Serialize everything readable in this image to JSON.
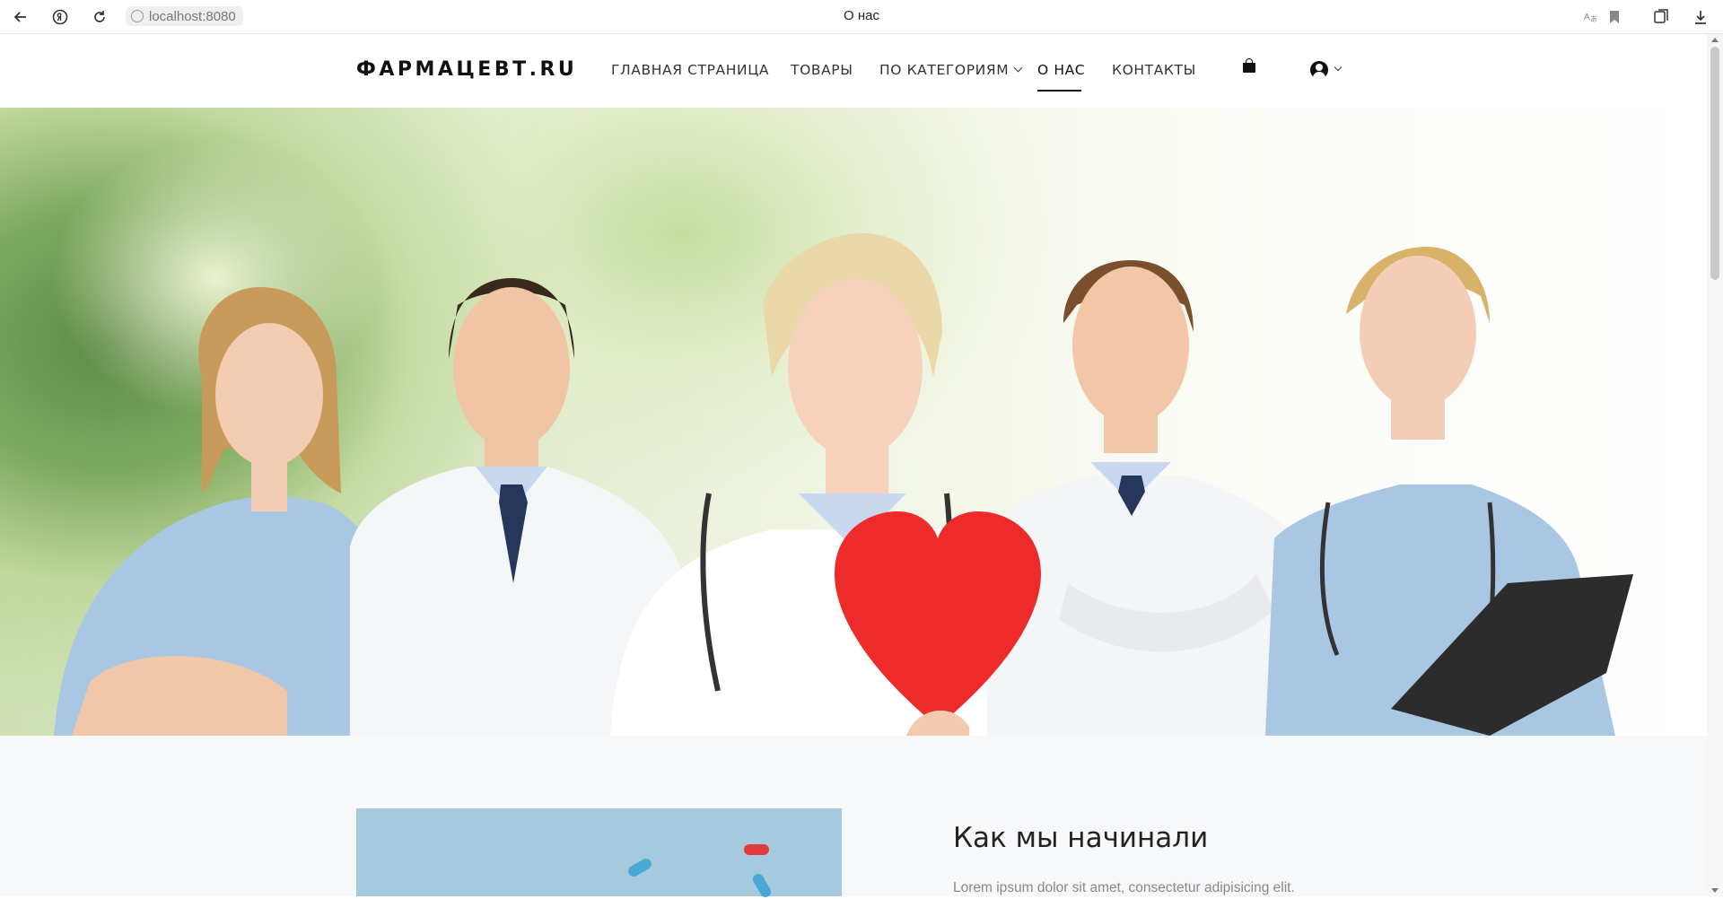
{
  "browser": {
    "url": "localhost:8080",
    "tab_title": "О нас",
    "back_icon": "back-arrow-icon",
    "reload_icon": "reload-icon"
  },
  "site": {
    "logo": "ФАРМАЦЕВТ.RU",
    "nav": [
      {
        "label": "ГЛАВНАЯ СТРАНИЦА"
      },
      {
        "label": "ТОВАРЫ"
      },
      {
        "label": "ПО КАТЕГОРИЯМ"
      },
      {
        "label": "О НАС",
        "active": true
      },
      {
        "label": "КОНТАКТЫ"
      }
    ],
    "cart_icon": "shopping-bag-icon",
    "account_icon": "user-circle-icon"
  },
  "about": {
    "title": "Как мы начинали",
    "text": "Lorem ipsum dolor sit amet, consectetur adipisicing elit."
  },
  "colors": {
    "accent": "#111111",
    "section_bg": "#f7f8fa",
    "image_bg": "#a5c9dd"
  }
}
